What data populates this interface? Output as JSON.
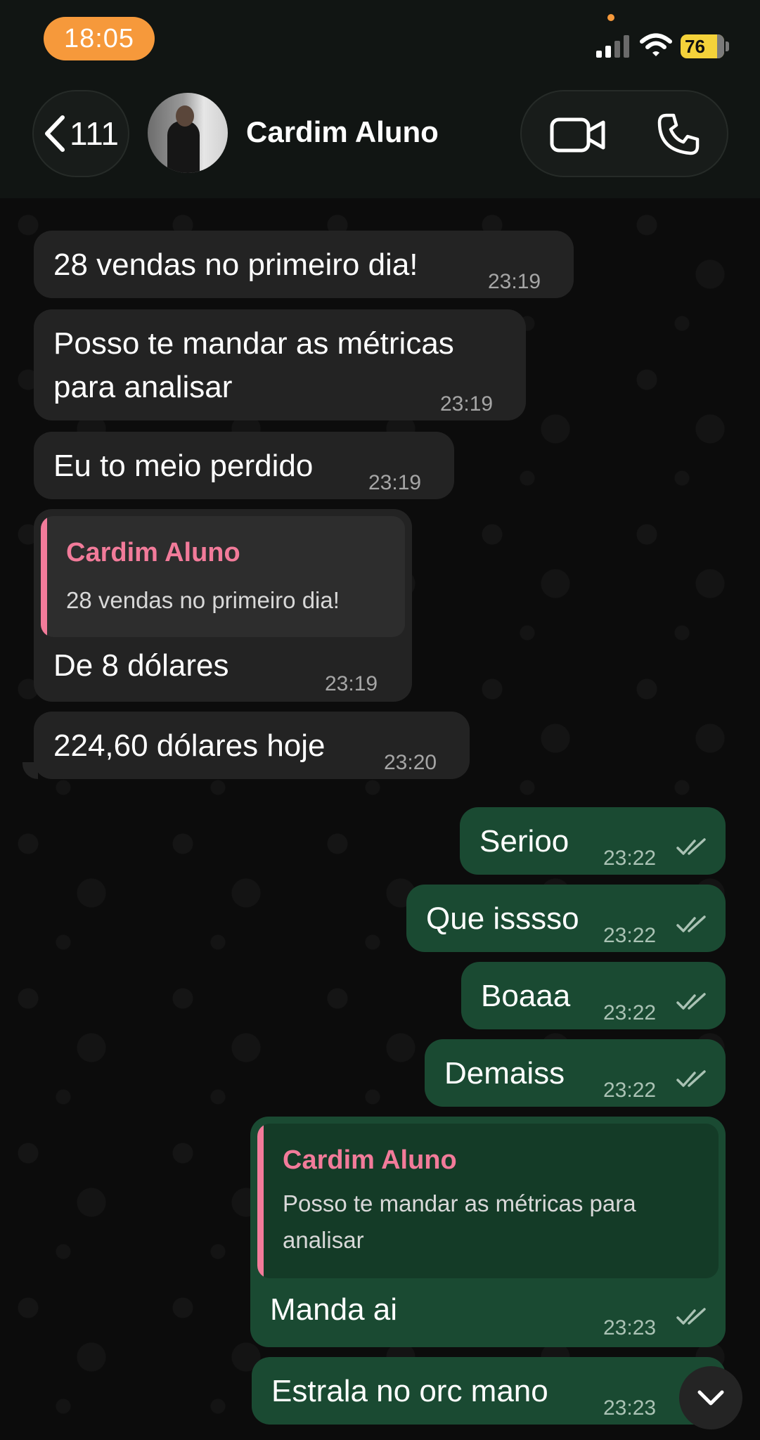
{
  "status_bar": {
    "time": "18:05",
    "battery": "76"
  },
  "header": {
    "back_count": "111",
    "contact_name": "Cardim Aluno"
  },
  "messages": [
    {
      "dir": "in",
      "text": "28 vendas no primeiro dia!",
      "time": "23:19"
    },
    {
      "dir": "in",
      "line1": "Posso te mandar as métricas",
      "line2": "para analisar",
      "time": "23:19"
    },
    {
      "dir": "in",
      "text": "Eu to meio perdido",
      "time": "23:19"
    },
    {
      "dir": "in",
      "quote_author": "Cardim Aluno",
      "quote_text": "28 vendas no primeiro dia!",
      "text": "De 8 dólares",
      "time": "23:19"
    },
    {
      "dir": "in",
      "text": "224,60 dólares hoje",
      "time": "23:20"
    },
    {
      "dir": "out",
      "text": "Serioo",
      "time": "23:22"
    },
    {
      "dir": "out",
      "text": "Que isssso",
      "time": "23:22"
    },
    {
      "dir": "out",
      "text": "Boaaa",
      "time": "23:22"
    },
    {
      "dir": "out",
      "text": "Demaiss",
      "time": "23:22"
    },
    {
      "dir": "out",
      "quote_author": "Cardim Aluno",
      "quote_line1": "Posso te mandar as métricas para",
      "quote_line2": "analisar",
      "text": "Manda ai",
      "time": "23:23"
    },
    {
      "dir": "out",
      "text": "Estrala no orc mano",
      "time": "23:23"
    }
  ],
  "colors": {
    "incoming_bubble": "#232323",
    "outgoing_bubble": "#1a4a32",
    "quote_accent": "#f27b9a",
    "time_pill": "#f6993b",
    "battery": "#f4d23a"
  },
  "icons": [
    "back-chevron-icon",
    "video-camera-icon",
    "phone-icon",
    "double-check-icon",
    "chevron-down-icon",
    "signal-icon",
    "wifi-icon",
    "battery-icon"
  ]
}
